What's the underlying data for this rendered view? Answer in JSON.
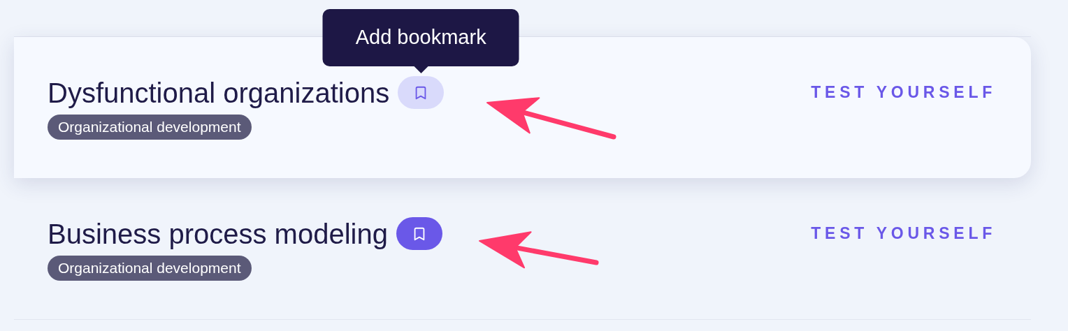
{
  "items": [
    {
      "title": "Dysfunctional organizations",
      "bookmarked": false,
      "highlighted": true,
      "tooltip": "Add bookmark",
      "tag": "Organizational development",
      "action": "TEST YOURSELF"
    },
    {
      "title": "Business process modeling",
      "bookmarked": true,
      "highlighted": false,
      "tag": "Organizational development",
      "action": "TEST YOURSELF"
    }
  ]
}
